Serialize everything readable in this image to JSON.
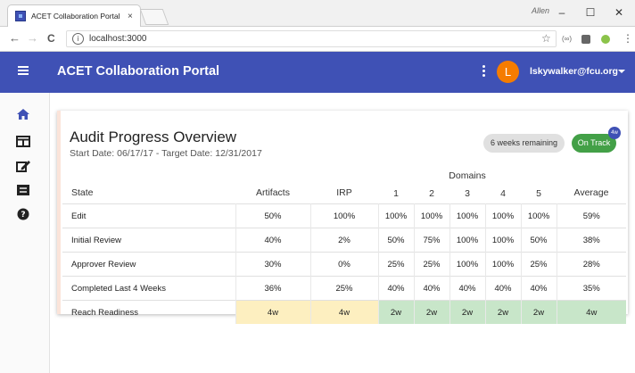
{
  "browser": {
    "tab_title": "ACET Collaboration Portal",
    "tab_close": "×",
    "os_user": "Allen",
    "url": "localhost:3000",
    "info_glyph": "i",
    "window_controls": {
      "minimize": "–",
      "maximize": "☐",
      "close": "✕"
    },
    "nav": {
      "back": "←",
      "forward": "→",
      "reload": "C"
    }
  },
  "header": {
    "title": "ACET Collaboration Portal",
    "avatar_initial": "L",
    "user_email": "lskywalker@fcu.org"
  },
  "sidebar": {
    "items": [
      {
        "name": "home",
        "glyph": "🏠"
      },
      {
        "name": "dashboard",
        "glyph": "▣"
      },
      {
        "name": "edit",
        "glyph": "✎"
      },
      {
        "name": "list",
        "glyph": "▤"
      },
      {
        "name": "help",
        "glyph": "?"
      }
    ]
  },
  "card": {
    "title": "Audit Progress Overview",
    "subtitle": "Start Date: 06/17/17 - Target Date: 12/31/2017",
    "remaining_chip": "6 weeks remaining",
    "status_button": "On Track",
    "status_badge": "4w"
  },
  "table": {
    "headers": {
      "state": "State",
      "artifacts": "Artifacts",
      "irp": "IRP",
      "domains": "Domains",
      "domain_numbers": [
        "1",
        "2",
        "3",
        "4",
        "5"
      ],
      "average": "Average"
    },
    "rows": [
      {
        "state": "Edit",
        "artifacts": "50%",
        "irp": "100%",
        "d1": "100%",
        "d2": "100%",
        "d3": "100%",
        "d4": "100%",
        "d5": "100%",
        "average": "59%"
      },
      {
        "state": "Initial Review",
        "artifacts": "40%",
        "irp": "2%",
        "d1": "50%",
        "d2": "75%",
        "d3": "100%",
        "d4": "100%",
        "d5": "50%",
        "average": "38%"
      },
      {
        "state": "Approver Review",
        "artifacts": "30%",
        "irp": "0%",
        "d1": "25%",
        "d2": "25%",
        "d3": "100%",
        "d4": "100%",
        "d5": "25%",
        "average": "28%"
      },
      {
        "state": "Completed Last 4 Weeks",
        "artifacts": "36%",
        "irp": "25%",
        "d1": "40%",
        "d2": "40%",
        "d3": "40%",
        "d4": "40%",
        "d5": "40%",
        "average": "35%"
      },
      {
        "state": "Reach Readiness",
        "artifacts": "4w",
        "irp": "4w",
        "d1": "2w",
        "d2": "2w",
        "d3": "2w",
        "d4": "2w",
        "d5": "2w",
        "average": "4w"
      }
    ]
  },
  "colors": {
    "primary": "#3f51b5",
    "avatar": "#f57c00",
    "on_track": "#43a047",
    "readiness_yellow": "#fdefc0",
    "readiness_green": "#c8e6c9"
  }
}
